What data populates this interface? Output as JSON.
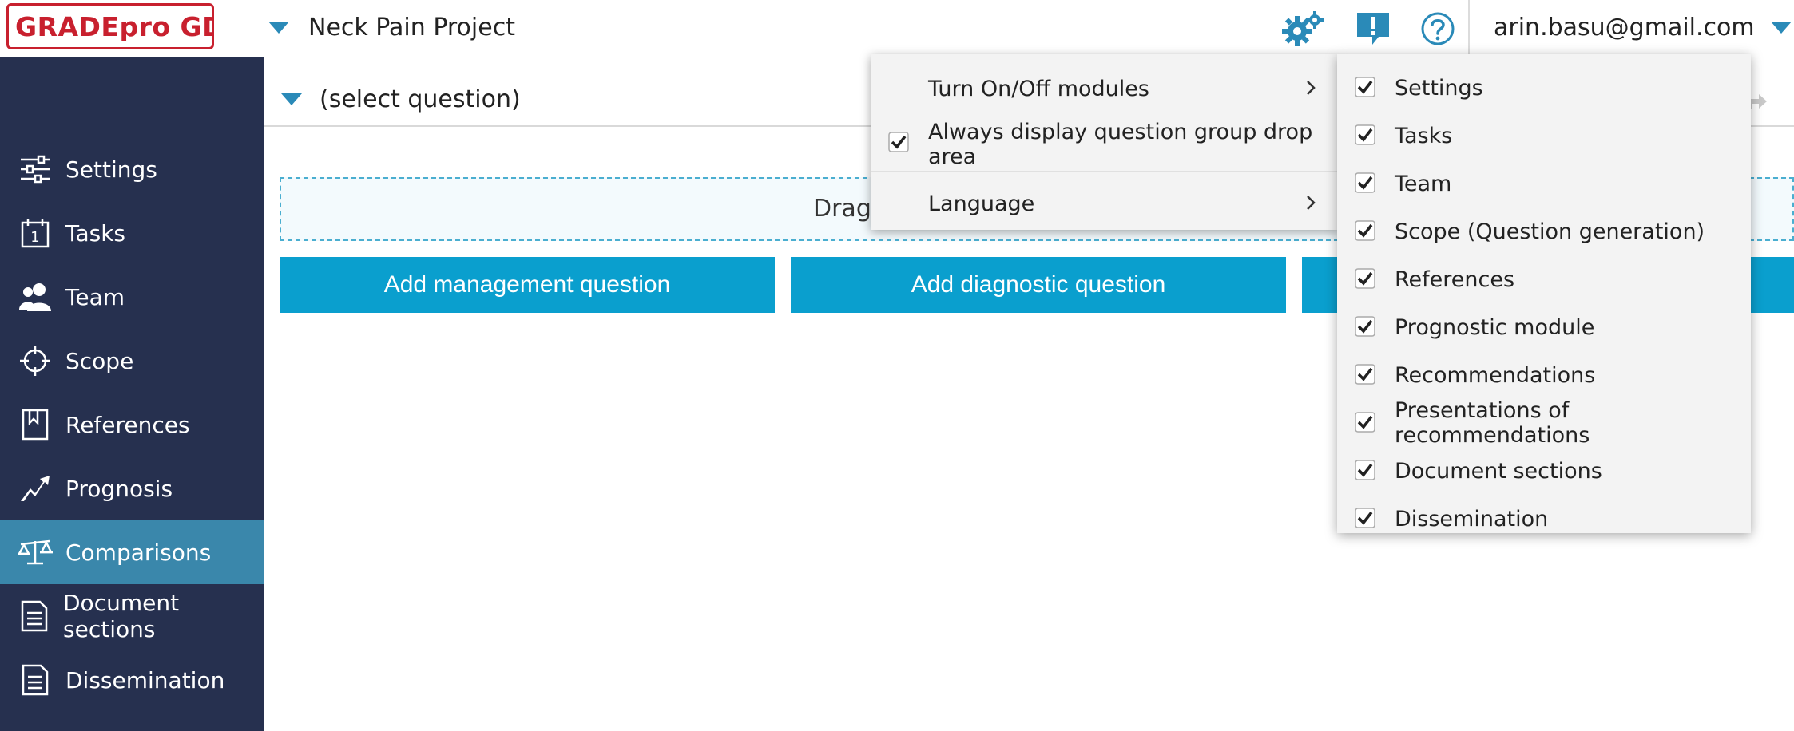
{
  "header": {
    "logo_left": "GRADEpro",
    "logo_right": "GDT",
    "project_name": "Neck Pain Project",
    "user_email": "arin.basu@gmail.com",
    "accent_color": "#2a8ab8",
    "icons": [
      "gear-icon",
      "feedback-icon",
      "help-icon",
      "chevron-down-icon"
    ]
  },
  "sidebar": {
    "background": "#26304f",
    "active_color": "#3a87ab",
    "items": [
      {
        "label": "Settings",
        "icon": "sliders-icon"
      },
      {
        "label": "Tasks",
        "icon": "calendar-icon"
      },
      {
        "label": "Team",
        "icon": "team-icon"
      },
      {
        "label": "Scope",
        "icon": "crosshair-icon"
      },
      {
        "label": "References",
        "icon": "bookmark-book-icon"
      },
      {
        "label": "Prognosis",
        "icon": "trend-arrow-icon"
      },
      {
        "label": "Comparisons",
        "icon": "scales-icon",
        "active": true
      },
      {
        "label": "Document sections",
        "icon": "document-icon"
      },
      {
        "label": "Dissemination",
        "icon": "document-icon"
      }
    ]
  },
  "main": {
    "question_select": "(select question)",
    "dropzone_text": "Drag",
    "buttons": {
      "add_management": "Add management question",
      "add_diagnostic": "Add diagnostic question"
    },
    "button_color": "#0a9fce"
  },
  "settings_menu": {
    "turn_on_off": "Turn On/Off modules",
    "always_display": "Always display question group drop area",
    "always_display_checked": true,
    "language": "Language"
  },
  "modules_menu": {
    "items": [
      {
        "label": "Settings",
        "checked": true
      },
      {
        "label": "Tasks",
        "checked": true
      },
      {
        "label": "Team",
        "checked": true
      },
      {
        "label": "Scope (Question generation)",
        "checked": true
      },
      {
        "label": "References",
        "checked": true
      },
      {
        "label": "Prognostic module",
        "checked": true
      },
      {
        "label": "Recommendations",
        "checked": true
      },
      {
        "label": "Presentations of recommendations",
        "checked": true
      },
      {
        "label": "Document sections",
        "checked": true
      },
      {
        "label": "Dissemination",
        "checked": true
      }
    ]
  }
}
